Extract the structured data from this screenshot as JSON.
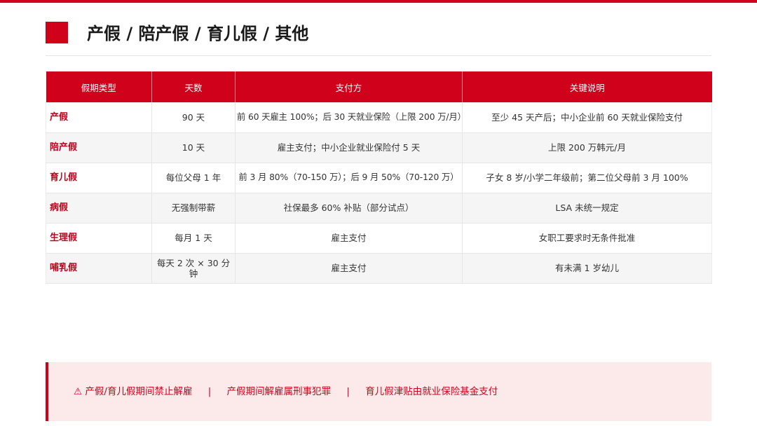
{
  "title": "产假 / 陪产假 / 育儿假 / 其他",
  "table": {
    "headers": [
      "假期类型",
      "天数",
      "支付方",
      "关键说明"
    ],
    "rows": [
      {
        "type": "产假",
        "days": "90 天",
        "payer": "前 60 天雇主 100%；后 30 天就业保险（上限 200 万/月）",
        "note": "至少 45 天产后；中小企业前 60 天就业保险支付"
      },
      {
        "type": "陪产假",
        "days": "10 天",
        "payer": "雇主支付；中小企业就业保险付 5 天",
        "note": "上限 200 万韩元/月"
      },
      {
        "type": "育儿假",
        "days": "每位父母 1 年",
        "payer": "前 3 月 80%（70-150 万）；后 9 月 50%（70-120 万）",
        "note": "子女 8 岁/小学二年级前；第二位父母前 3 月 100%"
      },
      {
        "type": "病假",
        "days": "无强制带薪",
        "payer": "社保最多 60% 补贴（部分试点）",
        "note": "LSA 未统一规定"
      },
      {
        "type": "生理假",
        "days": "每月 1 天",
        "payer": "雇主支付",
        "note": "女职工要求时无条件批准"
      },
      {
        "type": "哺乳假",
        "days": "每天 2 次 × 30 分钟",
        "payer": "雇主支付",
        "note": "有未满 1 岁幼儿"
      }
    ]
  },
  "notice": {
    "warning_icon": "⚠",
    "items": [
      "产假/育儿假期间禁止解雇",
      "产假期间解雇属刑事犯罪",
      "育儿假津贴由就业保险基金支付"
    ],
    "separator": "|"
  },
  "colors": {
    "accent": "#d0021b",
    "notice_bg": "#fce9ea",
    "row_alt": "#f5f5f5"
  }
}
